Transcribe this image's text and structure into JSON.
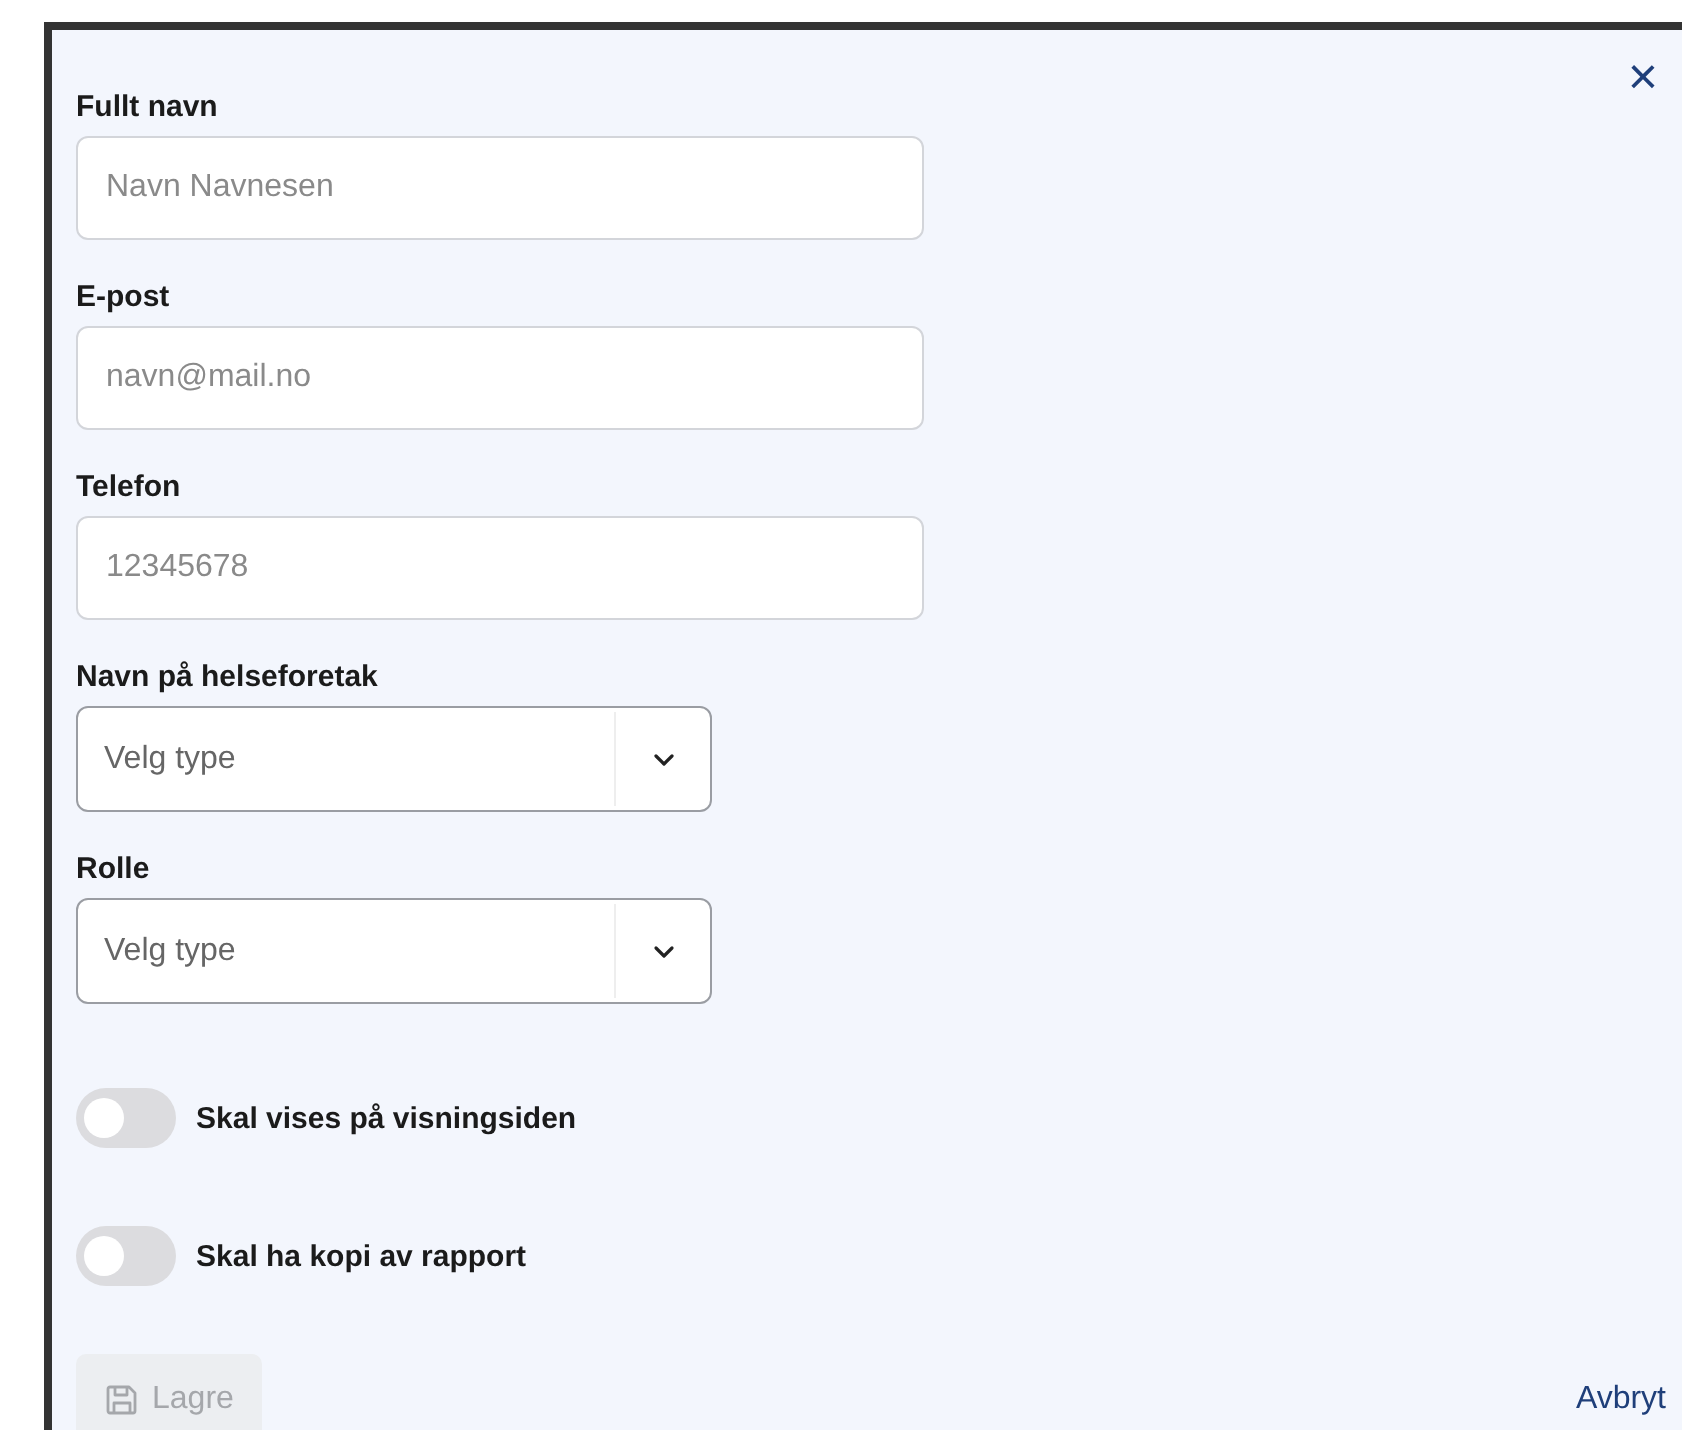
{
  "close_button": {
    "label": "×"
  },
  "fields": [
    {
      "kind": "text",
      "label": "Fullt navn",
      "placeholder": "Navn Navnesen"
    },
    {
      "kind": "text",
      "label": "E-post",
      "placeholder": "navn@mail.no"
    },
    {
      "kind": "text",
      "label": "Telefon",
      "placeholder": "12345678"
    },
    {
      "kind": "select",
      "label": "Navn på helseforetak",
      "placeholder": "Velg type"
    },
    {
      "kind": "select",
      "label": "Rolle",
      "placeholder": "Velg type"
    }
  ],
  "toggles": [
    {
      "label": "Skal vises på visningsiden",
      "on": false
    },
    {
      "label": "Skal ha kopi av rapport",
      "on": false
    }
  ],
  "save_button": {
    "label": "Lagre",
    "disabled": true
  },
  "cancel_link": {
    "label": "Avbryt"
  }
}
